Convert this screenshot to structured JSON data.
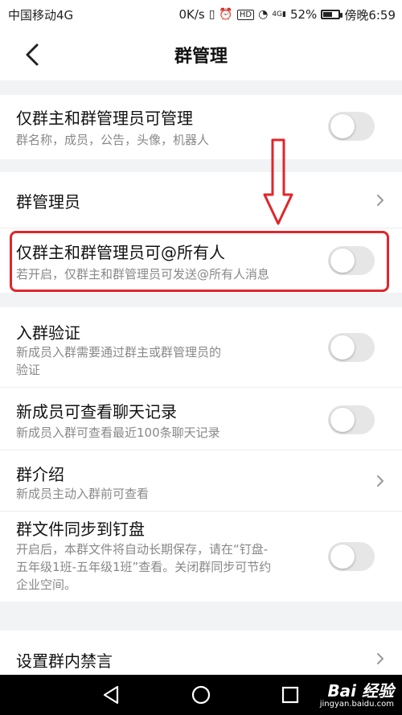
{
  "status": {
    "carrier": "中国移动4G",
    "speed": "0K/s",
    "hd": "HD",
    "net": "4G",
    "battery": "52%",
    "time": "傍晚6:59",
    "battery_level": 0.52
  },
  "header": {
    "title": "群管理"
  },
  "settings": {
    "admin_only": {
      "title": "仅群主和群管理员可管理",
      "subtitle": "群名称，成员，公告，头像，机器人",
      "enabled": false
    },
    "admins": {
      "title": "群管理员"
    },
    "at_all": {
      "title": "仅群主和群管理员可@所有人",
      "subtitle": "若开启，仅群主和群管理员可发送@所有人消息",
      "enabled": false
    },
    "verify": {
      "title": "入群验证",
      "subtitle_line1": "新成员入群需要通过群主或群管理员的",
      "subtitle_line2": "验证",
      "enabled": false
    },
    "history": {
      "title": "新成员可查看聊天记录",
      "subtitle": "新成员入群可查看最近100条聊天记录",
      "enabled": false
    },
    "intro": {
      "title": "群介绍",
      "subtitle": "新成员主动入群前可查看"
    },
    "file_sync": {
      "title": "群文件同步到钉盘",
      "subtitle_line1": "开启后，本群文件将自动长期保存，请在“钉盘-",
      "subtitle_line2": "五年级1班-五年级1班”查看。关闭群同步可节约",
      "subtitle_line3": "企业空间。",
      "enabled": false
    },
    "mute": {
      "title": "设置群内禁言"
    }
  },
  "watermark": {
    "main": "Bai 经验",
    "sub": "jingyan.baidu.com"
  },
  "colors": {
    "highlight": "#e0262b",
    "toggle_off": "#e6e6e6",
    "background": "#f2f3f5"
  }
}
